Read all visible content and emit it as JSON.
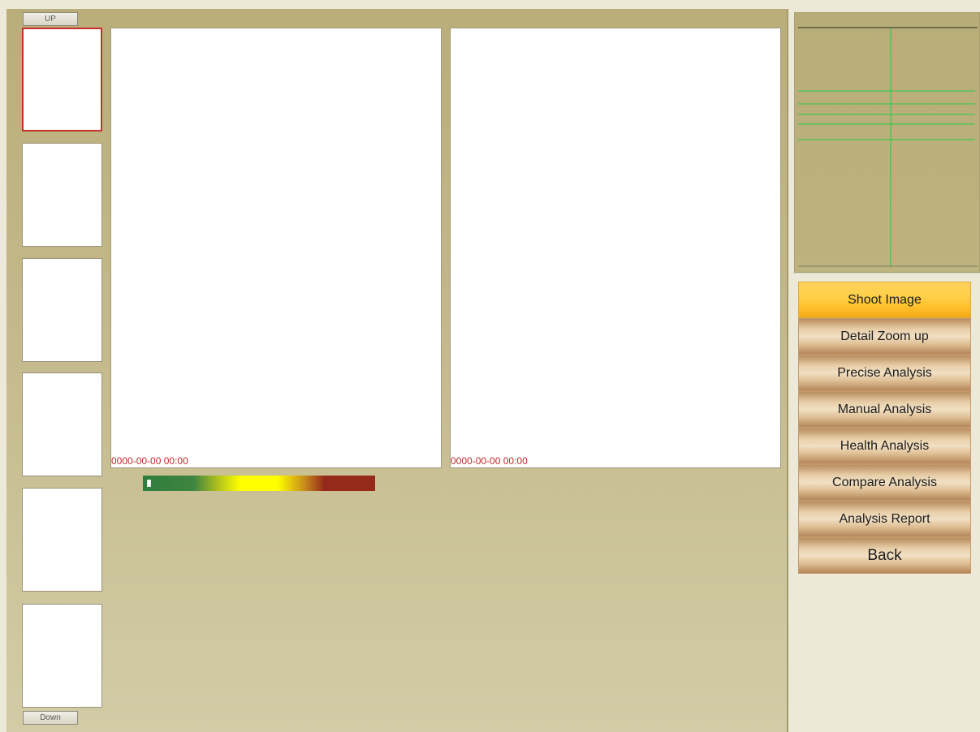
{
  "thumbnails": {
    "up_label": "UP",
    "down_label": "Down",
    "count": 6,
    "selected_index": 0
  },
  "views": [
    {
      "timestamp": "0000-00-00 00:00"
    },
    {
      "timestamp": "0000-00-00 00:00"
    }
  ],
  "menu": {
    "items": [
      {
        "label": "Shoot Image",
        "active": true
      },
      {
        "label": "Detail Zoom up",
        "active": false
      },
      {
        "label": "Precise Analysis",
        "active": false
      },
      {
        "label": "Manual Analysis",
        "active": false
      },
      {
        "label": "Health Analysis",
        "active": false
      },
      {
        "label": "Compare Analysis",
        "active": false
      },
      {
        "label": "Analysis Report",
        "active": false
      },
      {
        "label": "Back",
        "active": false
      }
    ]
  },
  "colors": {
    "selected_border": "#c8302a",
    "timestamp": "#c0282a",
    "active_button": "#ffc12a",
    "guide_lines": "#22cc44"
  }
}
